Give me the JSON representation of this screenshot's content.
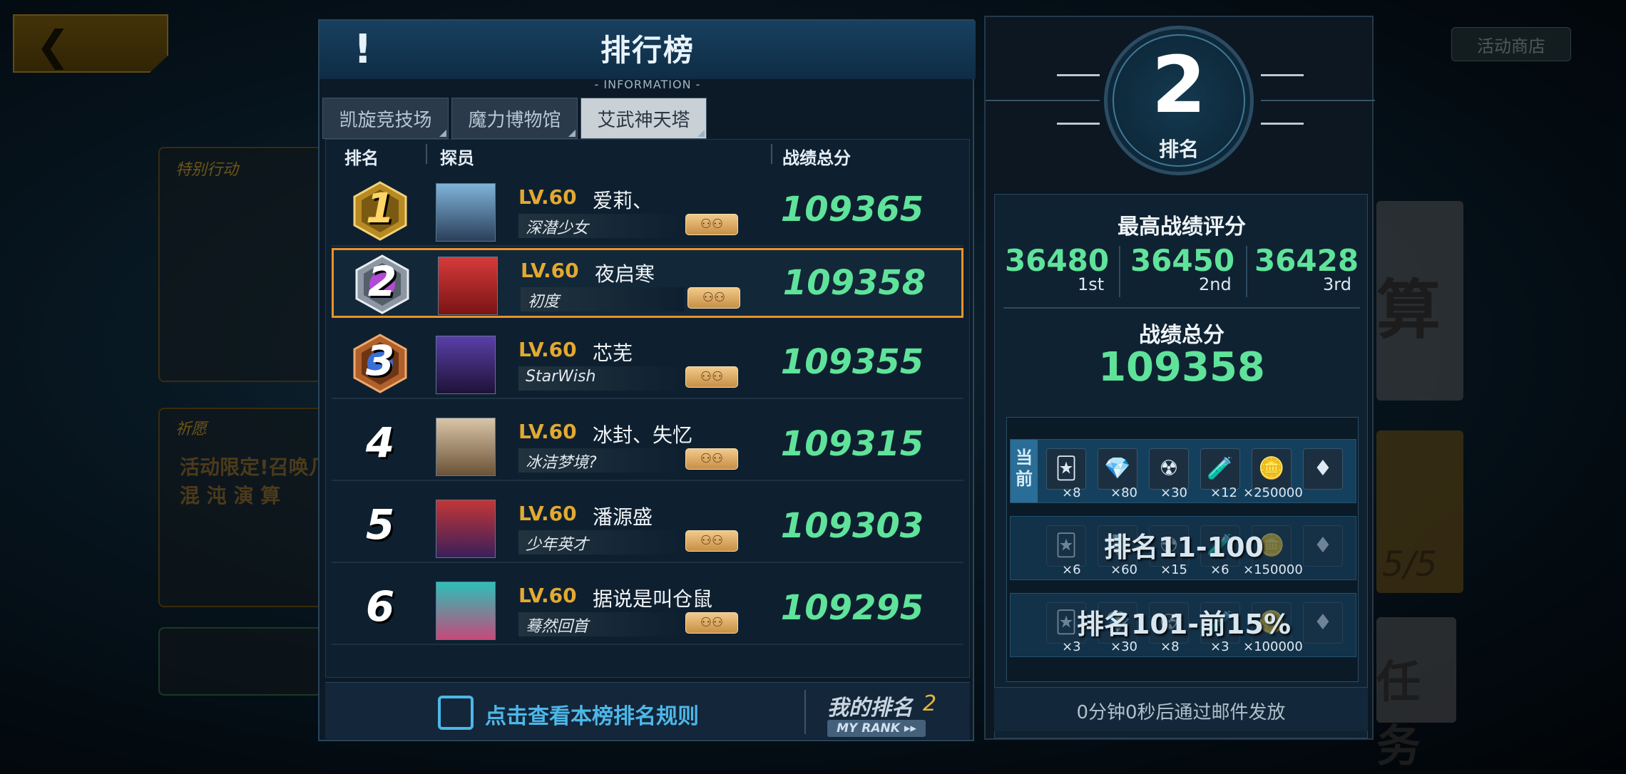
{
  "background": {
    "shop_label": "活动商店",
    "card1_label": "特别行动",
    "card2_label": "祈愿",
    "card2_line1": "活动限定!召唤几率",
    "card2_line2": "混 沌 演 算",
    "right_text1": "算",
    "right_text2": "5/5",
    "right_text3": "任务"
  },
  "panel": {
    "title": "排行榜",
    "subtitle": "- INFORMATION -",
    "tabs": [
      {
        "label": "凯旋竞技场",
        "active": false
      },
      {
        "label": "魔力博物馆",
        "active": false
      },
      {
        "label": "艾武神天塔",
        "active": true
      }
    ],
    "columns": {
      "rank": "排名",
      "member": "探员",
      "score": "战绩总分"
    },
    "rows": [
      {
        "rank": "1",
        "level": "LV.60",
        "name": "爱莉、",
        "title": "深潜少女",
        "score": "109365",
        "is_me": false,
        "badge": "gold"
      },
      {
        "rank": "2",
        "level": "LV.60",
        "name": "夜启寒",
        "title": "初度",
        "score": "109358",
        "is_me": true,
        "badge": "silver"
      },
      {
        "rank": "3",
        "level": "LV.60",
        "name": "芯芜",
        "title": "StarWish",
        "score": "109355",
        "is_me": false,
        "badge": "bronze"
      },
      {
        "rank": "4",
        "level": "LV.60",
        "name": "冰封、失忆",
        "title": "冰洁梦境?",
        "score": "109315",
        "is_me": false,
        "badge": "none"
      },
      {
        "rank": "5",
        "level": "LV.60",
        "name": "潘源盛",
        "title": "少年英才",
        "score": "109303",
        "is_me": false,
        "badge": "none"
      },
      {
        "rank": "6",
        "level": "LV.60",
        "name": "据说是叫仓鼠",
        "title": "蓦然回首",
        "score": "109295",
        "is_me": false,
        "badge": "none"
      }
    ],
    "footer": {
      "rule_text": "点击查看本榜排名规则",
      "my_rank_label": "我的排名",
      "my_rank_value": "2",
      "my_rank_en": "MY RANK ▸▸"
    }
  },
  "right": {
    "rank_number": "2",
    "rank_label": "排名",
    "best_title": "最高战绩评分",
    "best": [
      {
        "value": "36480",
        "place": "1st"
      },
      {
        "value": "36450",
        "place": "2nd"
      },
      {
        "value": "36428",
        "place": "3rd"
      }
    ],
    "total_label": "战绩总分",
    "total_value": "109358",
    "current_label": "当前",
    "reward_tiers": [
      {
        "label": "",
        "quantities": [
          "×8",
          "×80",
          "×30",
          "×12",
          "×250000",
          ""
        ]
      },
      {
        "label": "排名11-100",
        "quantities": [
          "×6",
          "×60",
          "×15",
          "×6",
          "×150000",
          ""
        ]
      },
      {
        "label": "排名101-前15%",
        "quantities": [
          "×3",
          "×30",
          "×8",
          "×3",
          "×100000",
          ""
        ]
      }
    ],
    "mail_text": "0分钟0秒后通过邮件发放"
  }
}
